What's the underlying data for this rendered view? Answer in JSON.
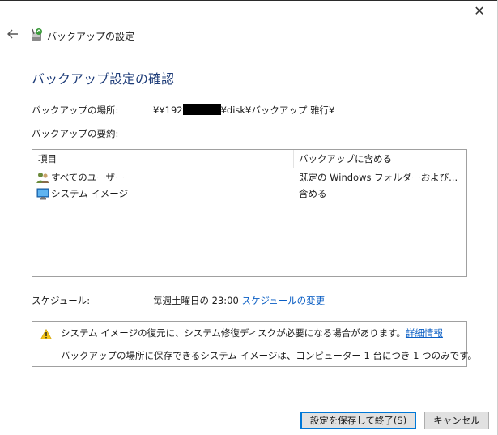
{
  "window": {
    "close_glyph": "✕"
  },
  "header": {
    "title": "バックアップの設定",
    "back_icon": "arrow-left-icon",
    "app_icon": "backup-icon"
  },
  "page": {
    "title": "バックアップ設定の確認",
    "location_label": "バックアップの場所:",
    "location_prefix": "¥¥192",
    "location_suffix": "¥disk¥バックアップ 雅行¥",
    "summary_label": "バックアップの要約:"
  },
  "summary_table": {
    "columns": [
      "項目",
      "バックアップに含める"
    ],
    "rows": [
      {
        "item": "すべてのユーザー",
        "value": "既定の Windows フォルダーおよび...",
        "icon": "users-icon"
      },
      {
        "item": "システム イメージ",
        "value": "含める",
        "icon": "monitor-icon"
      }
    ]
  },
  "schedule": {
    "label": "スケジュール:",
    "value": "毎週土曜日の 23:00",
    "change_link": "スケジュールの変更"
  },
  "info": {
    "warning_text": "システム イメージの復元に、システム修復ディスクが必要になる場合があります。",
    "details_link": "詳細情報",
    "note_text": "バックアップの場所に保存できるシステム イメージは、コンピューター 1 台につき 1 つのみです。"
  },
  "buttons": {
    "save_label": "設定を保存して終了(S)",
    "cancel_label": "キャンセル"
  },
  "colors": {
    "title_blue": "#1e3c78",
    "link_blue": "#0a5ec4",
    "accent": "#0078d7",
    "warning_yellow": "#f5c518"
  }
}
